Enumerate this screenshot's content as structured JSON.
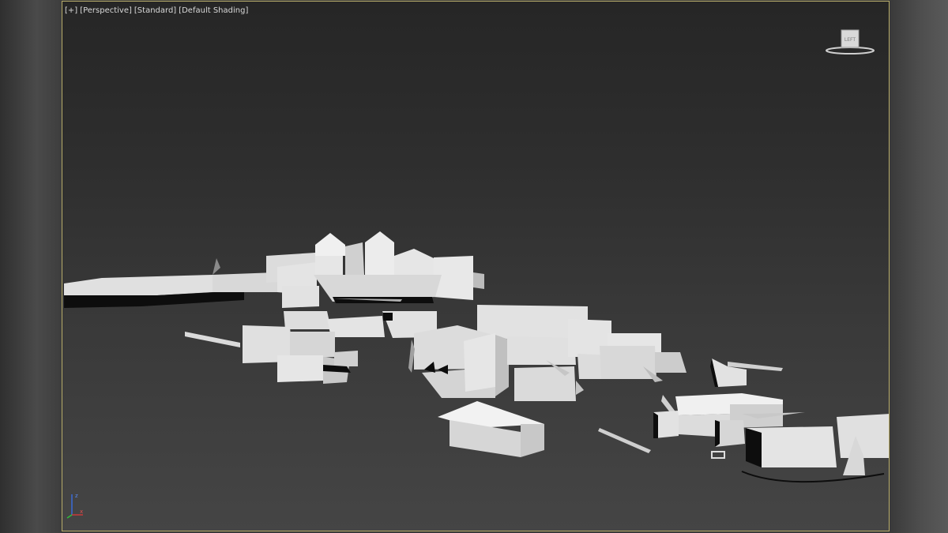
{
  "viewport": {
    "labels": {
      "plus": "[+]",
      "view": "[Perspective]",
      "preset": "[Standard]",
      "shading": "[Default Shading]"
    },
    "viewcube_face": "LEFT",
    "axes": [
      "x",
      "y",
      "z"
    ]
  },
  "colors": {
    "border_active": "#b8ad6a",
    "label_text": "#d8d8d8",
    "model_face_light": "#e2e2e2",
    "model_face_mid": "#c4c4c4",
    "model_face_dark": "#0c0c0c"
  },
  "icons": {
    "viewcube": "viewcube-icon",
    "axis": "axis-tripod-icon"
  }
}
